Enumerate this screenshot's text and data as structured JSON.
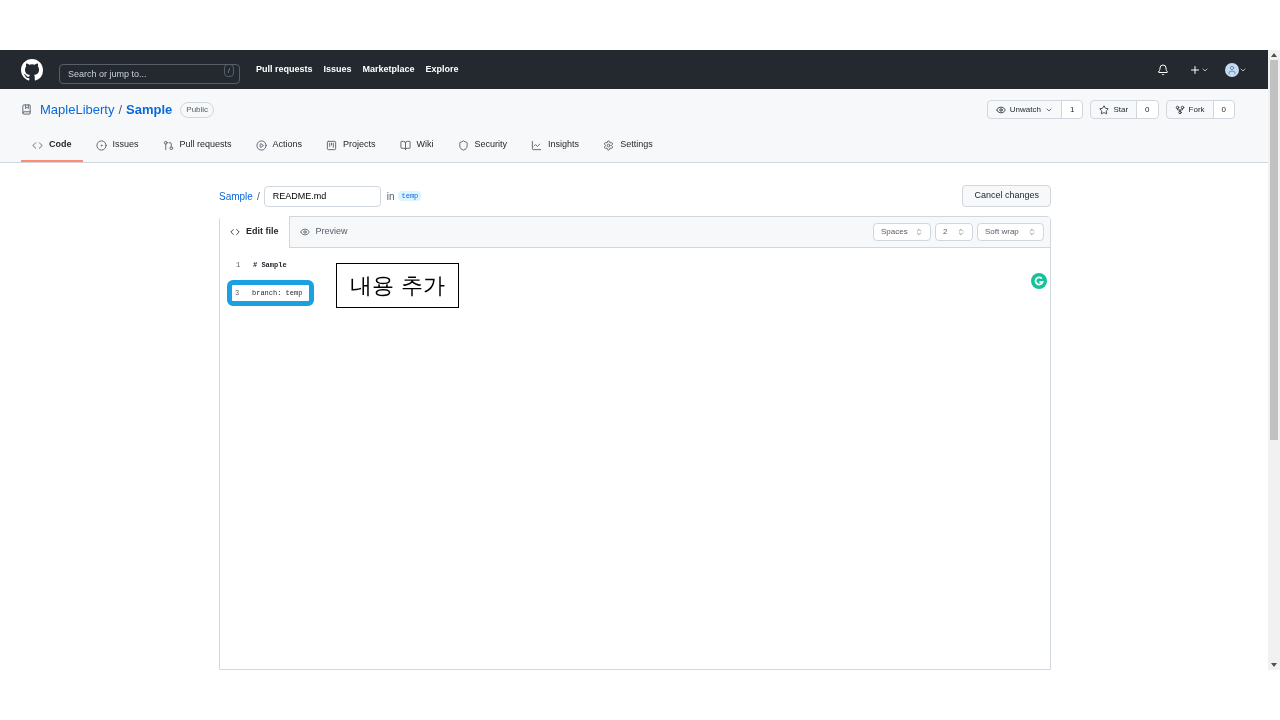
{
  "header": {
    "search_placeholder": "Search or jump to...",
    "search_key": "/",
    "nav": [
      "Pull requests",
      "Issues",
      "Marketplace",
      "Explore"
    ]
  },
  "repo": {
    "owner": "MapleLiberty",
    "separator": "/",
    "name": "Sample",
    "visibility": "Public",
    "actions": [
      {
        "kind": "watch",
        "label": "Unwatch",
        "count": "1"
      },
      {
        "kind": "star",
        "label": "Star",
        "count": "0"
      },
      {
        "kind": "fork",
        "label": "Fork",
        "count": "0"
      }
    ],
    "tabs": [
      {
        "kind": "code",
        "label": "Code",
        "selected": true
      },
      {
        "kind": "issues",
        "label": "Issues",
        "selected": false
      },
      {
        "kind": "pulls",
        "label": "Pull requests",
        "selected": false
      },
      {
        "kind": "actions",
        "label": "Actions",
        "selected": false
      },
      {
        "kind": "projects",
        "label": "Projects",
        "selected": false
      },
      {
        "kind": "wiki",
        "label": "Wiki",
        "selected": false
      },
      {
        "kind": "security",
        "label": "Security",
        "selected": false
      },
      {
        "kind": "insights",
        "label": "Insights",
        "selected": false
      },
      {
        "kind": "settings",
        "label": "Settings",
        "selected": false
      }
    ]
  },
  "editor": {
    "breadcrumb": "Sample",
    "separator": "/",
    "filename": "README.md",
    "in_label": "in",
    "branch": "temp",
    "cancel_button": "Cancel changes",
    "tabs": [
      {
        "kind": "edit",
        "label": "Edit file",
        "selected": true
      },
      {
        "kind": "preview",
        "label": "Preview",
        "selected": false
      }
    ],
    "selects": [
      "Spaces",
      "2",
      "Soft wrap"
    ],
    "lines": [
      {
        "number": "1",
        "text": "# Sample",
        "highlighted": false
      },
      {
        "number": "3",
        "text": "branch: temp",
        "highlighted": true
      }
    ],
    "annotation": "내용 추가"
  }
}
